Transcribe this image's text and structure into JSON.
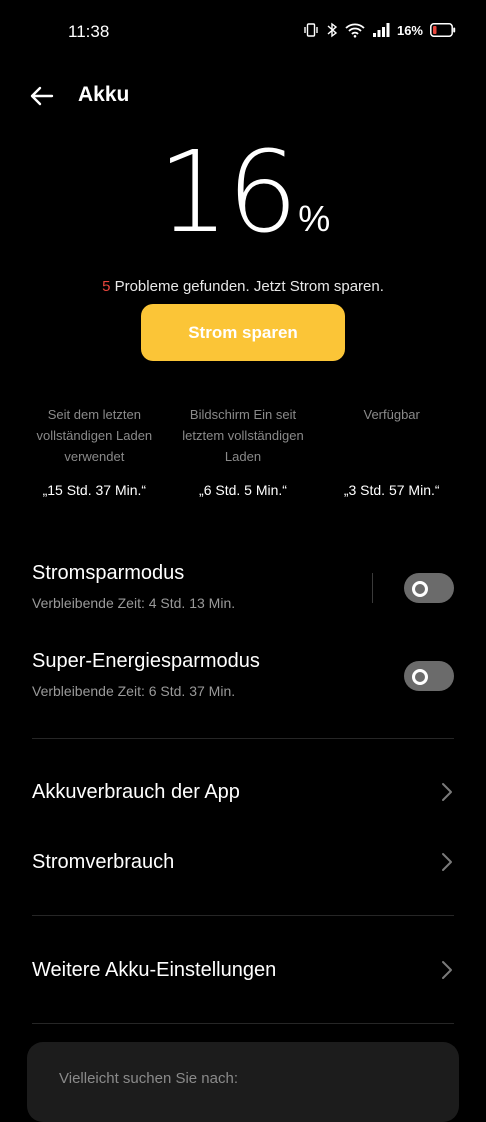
{
  "status_bar": {
    "time": "11:38",
    "battery_percent": "16%"
  },
  "header": {
    "title": "Akku"
  },
  "battery": {
    "level": "16",
    "unit": "%"
  },
  "problems": {
    "count": "5",
    "text": " Probleme gefunden. Jetzt Strom sparen."
  },
  "save_button": {
    "label": "Strom sparen"
  },
  "stats": [
    {
      "label": "Seit dem letzten vollständigen Laden verwendet",
      "value": "„15 Std. 37 Min.“"
    },
    {
      "label": "Bildschirm Ein seit letztem vollständigen Laden",
      "value": "„6 Std. 5 Min.“"
    },
    {
      "label": "Verfügbar",
      "value": "„3 Std. 57 Min.“"
    }
  ],
  "power_saving": {
    "title": "Stromsparmodus",
    "subtitle": "Verbleibende Zeit:  4 Std. 13 Min.",
    "enabled": false
  },
  "super_saving": {
    "title": "Super-Energiesparmodus",
    "subtitle": "Verbleibende Zeit:  6 Std. 37 Min.",
    "enabled": false
  },
  "menu": {
    "app_usage": "Akkuverbrauch der App",
    "power_consumption": "Stromverbrauch",
    "more_settings": "Weitere Akku-Einstellungen"
  },
  "suggestion": {
    "text": "Vielleicht suchen Sie nach:"
  },
  "colors": {
    "accent": "#fbc537",
    "alert": "#e8453c",
    "toggle_off": "#6b6b6b"
  }
}
